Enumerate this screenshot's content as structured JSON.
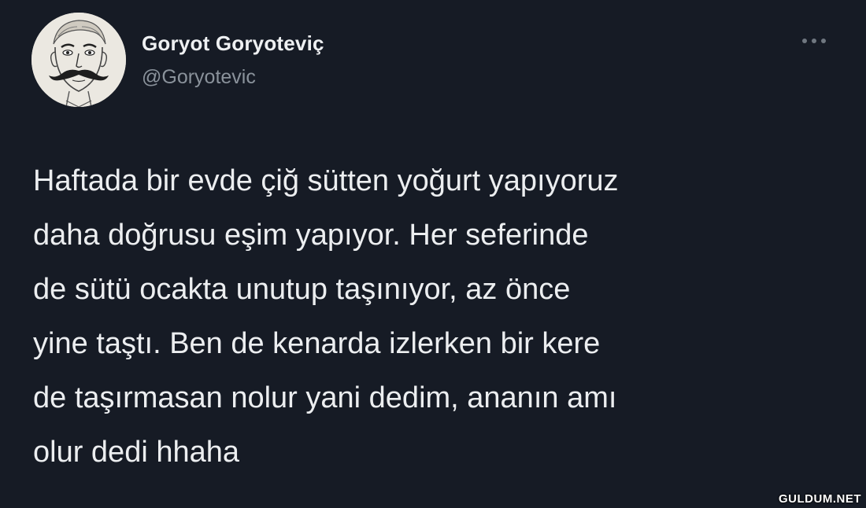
{
  "tweet": {
    "author": {
      "display_name": "Goryot Goryoteviç",
      "handle": "@Goryotevic",
      "avatar_icon": "mustache-portrait-avatar"
    },
    "more_icon": "more-options-icon",
    "text": "Haftada bir evde çiğ sütten yoğurt yapıyoruz\ndaha doğrusu eşim yapıyor. Her seferinde\nde sütü ocakta unutup taşınıyor, az önce\nyine taştı. Ben de kenarda izlerken bir kere\nde taşırmasan nolur yani dedim, ananın amı\nolur dedi hhaha"
  },
  "watermark": "GULDUM.NET",
  "colors": {
    "background": "#161b25",
    "text": "#eceef0",
    "secondary_text": "#8a929b"
  }
}
